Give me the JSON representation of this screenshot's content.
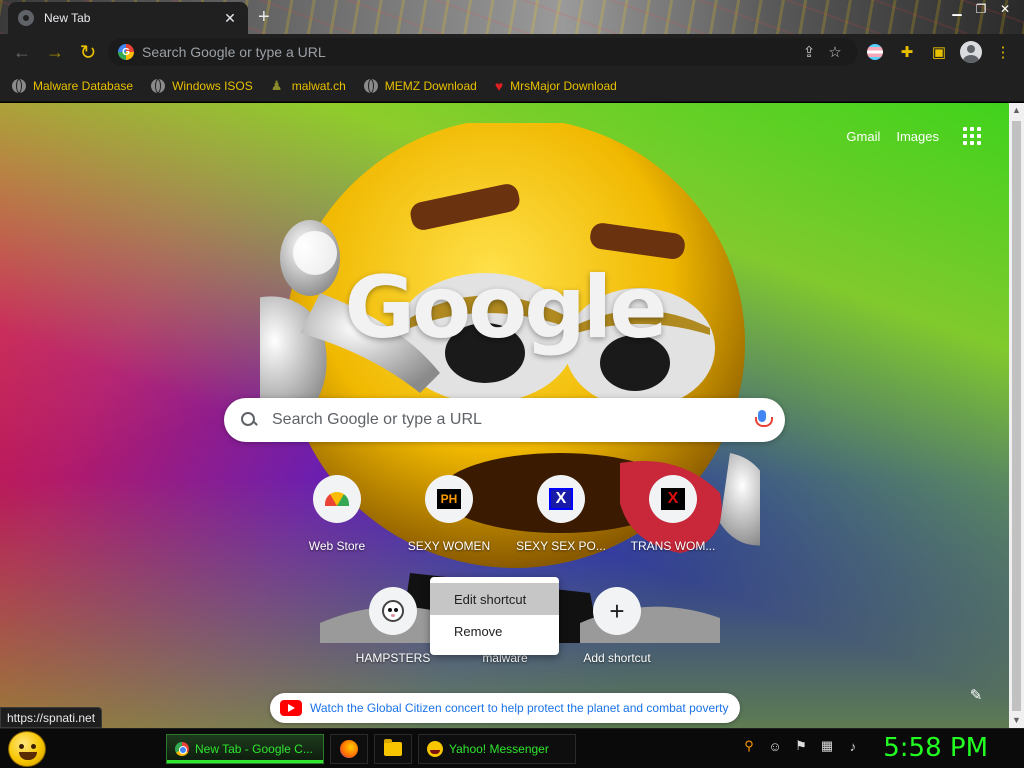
{
  "window": {
    "tab_title": "New Tab",
    "tab_close_glyph": "✕",
    "new_tab_glyph": "+"
  },
  "toolbar": {
    "omnibox_placeholder": "Search Google or type a URL",
    "icons": [
      "back-icon",
      "forward-icon",
      "reload-icon",
      "share-icon",
      "star-icon",
      "flag-icon",
      "puzzle-icon",
      "sidepanel-icon",
      "profile-icon",
      "menu-icon"
    ]
  },
  "bookmarks": [
    {
      "label": "Malware Database",
      "icon": "globe-icon"
    },
    {
      "label": "Windows ISOS",
      "icon": "globe-icon"
    },
    {
      "label": "malwat.ch",
      "icon": "person-icon"
    },
    {
      "label": "MEMZ Download",
      "icon": "globe-icon"
    },
    {
      "label": "MrsMajor Download",
      "icon": "heart-icon"
    }
  ],
  "page": {
    "top_links": {
      "gmail": "Gmail",
      "images": "Images"
    },
    "logo": "Google",
    "search_placeholder": "Search Google or type a URL",
    "shortcuts": [
      {
        "label": "Web Store",
        "icon": "webstore-icon",
        "glyph": ""
      },
      {
        "label": "SEXY WOMEN",
        "icon": "ph-icon",
        "glyph": "PH"
      },
      {
        "label": "SEXY SEX PO...",
        "icon": "x-blue-icon",
        "glyph": "X"
      },
      {
        "label": "TRANS WOM...",
        "icon": "x-red-icon",
        "glyph": "X"
      },
      {
        "label": "HAMPSTERS",
        "icon": "hamster-icon",
        "glyph": ""
      },
      {
        "label": "malware",
        "icon": "eye-pyramid-icon",
        "glyph": ""
      },
      {
        "label": "Add shortcut",
        "icon": "plus-icon",
        "glyph": "+"
      }
    ],
    "context_menu": {
      "items": [
        "Edit shortcut",
        "Remove"
      ],
      "highlighted": 0
    },
    "banner_text": "Watch the Global Citizen concert to help protect the planet and combat poverty",
    "status_url": "https://spnati.net"
  },
  "taskbar": {
    "tasks": [
      {
        "label": "New Tab - Google C...",
        "icon": "chrome-icon",
        "active": true
      },
      {
        "label": "",
        "icon": "firefox-icon",
        "active": false
      },
      {
        "label": "",
        "icon": "folder-icon",
        "active": false
      },
      {
        "label": "Yahoo! Messenger",
        "icon": "yahoo-icon",
        "active": false
      }
    ],
    "clock": "5:58 PM",
    "colors": {
      "clock": "#22ff22",
      "task_text": "#2ee62e",
      "bookmark_text": "#e8c000"
    }
  }
}
